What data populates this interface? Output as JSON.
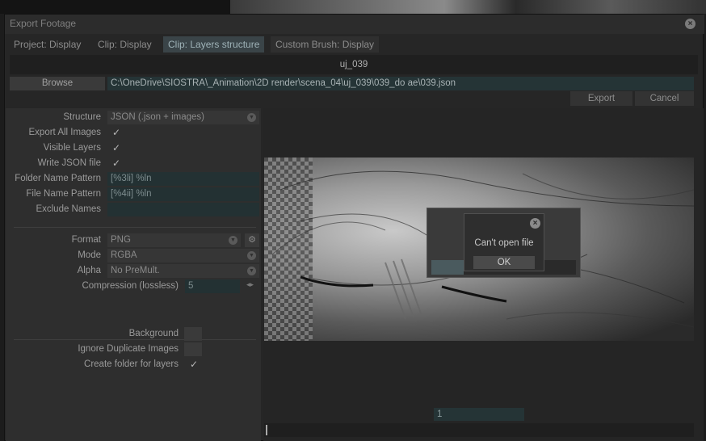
{
  "window": {
    "title": "Export Footage"
  },
  "tabs": [
    {
      "label": "Project: Display"
    },
    {
      "label": "Clip: Display"
    },
    {
      "label": "Clip: Layers structure"
    },
    {
      "label": "Custom Brush: Display"
    }
  ],
  "header": {
    "clip_name": "uj_039"
  },
  "browse": {
    "label": "Browse",
    "path": "C:\\OneDrive\\SIOSTRA\\_Animation\\2D render\\scena_04\\uj_039\\039_do ae\\039.json"
  },
  "actions": {
    "export_label": "Export",
    "cancel_label": "Cancel"
  },
  "settings": {
    "structure_label": "Structure",
    "structure_value": "JSON (.json + images)",
    "export_all_images_label": "Export All Images",
    "export_all_images_checked": true,
    "visible_layers_label": "Visible Layers",
    "visible_layers_checked": true,
    "write_json_label": "Write JSON file",
    "write_json_checked": true,
    "folder_pattern_label": "Folder Name Pattern",
    "folder_pattern_value": "[%3li] %ln",
    "file_pattern_label": "File Name Pattern",
    "file_pattern_value": "[%4ii] %ln",
    "exclude_label": "Exclude Names",
    "exclude_value": "",
    "format_label": "Format",
    "format_value": "PNG",
    "mode_label": "Mode",
    "mode_value": "RGBA",
    "alpha_label": "Alpha",
    "alpha_value": "No PreMult.",
    "compression_label": "Compression (lossless)",
    "compression_value": "5",
    "background_label": "Background",
    "ignore_dup_label": "Ignore Duplicate Images",
    "create_folder_label": "Create folder for layers",
    "create_folder_checked": true
  },
  "check_glyph": "✓",
  "dialog": {
    "message": "Can't open file",
    "ok_label": "OK"
  },
  "timeline": {
    "frame": "1"
  }
}
